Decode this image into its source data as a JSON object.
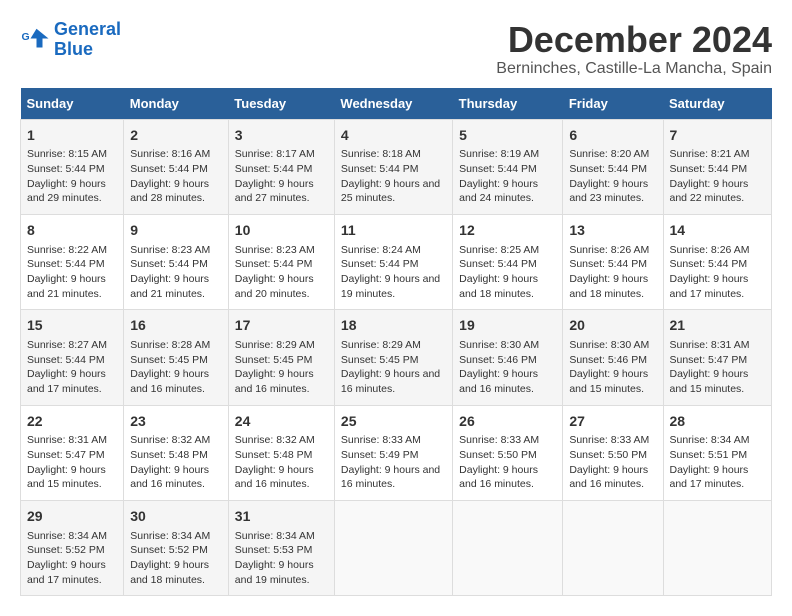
{
  "logo": {
    "line1": "General",
    "line2": "Blue"
  },
  "title": "December 2024",
  "subtitle": "Berninches, Castille-La Mancha, Spain",
  "headers": [
    "Sunday",
    "Monday",
    "Tuesday",
    "Wednesday",
    "Thursday",
    "Friday",
    "Saturday"
  ],
  "weeks": [
    [
      {
        "day": "1",
        "sunrise": "8:15 AM",
        "sunset": "5:44 PM",
        "daylight": "9 hours and 29 minutes."
      },
      {
        "day": "2",
        "sunrise": "8:16 AM",
        "sunset": "5:44 PM",
        "daylight": "9 hours and 28 minutes."
      },
      {
        "day": "3",
        "sunrise": "8:17 AM",
        "sunset": "5:44 PM",
        "daylight": "9 hours and 27 minutes."
      },
      {
        "day": "4",
        "sunrise": "8:18 AM",
        "sunset": "5:44 PM",
        "daylight": "9 hours and 25 minutes."
      },
      {
        "day": "5",
        "sunrise": "8:19 AM",
        "sunset": "5:44 PM",
        "daylight": "9 hours and 24 minutes."
      },
      {
        "day": "6",
        "sunrise": "8:20 AM",
        "sunset": "5:44 PM",
        "daylight": "9 hours and 23 minutes."
      },
      {
        "day": "7",
        "sunrise": "8:21 AM",
        "sunset": "5:44 PM",
        "daylight": "9 hours and 22 minutes."
      }
    ],
    [
      {
        "day": "8",
        "sunrise": "8:22 AM",
        "sunset": "5:44 PM",
        "daylight": "9 hours and 21 minutes."
      },
      {
        "day": "9",
        "sunrise": "8:23 AM",
        "sunset": "5:44 PM",
        "daylight": "9 hours and 21 minutes."
      },
      {
        "day": "10",
        "sunrise": "8:23 AM",
        "sunset": "5:44 PM",
        "daylight": "9 hours and 20 minutes."
      },
      {
        "day": "11",
        "sunrise": "8:24 AM",
        "sunset": "5:44 PM",
        "daylight": "9 hours and 19 minutes."
      },
      {
        "day": "12",
        "sunrise": "8:25 AM",
        "sunset": "5:44 PM",
        "daylight": "9 hours and 18 minutes."
      },
      {
        "day": "13",
        "sunrise": "8:26 AM",
        "sunset": "5:44 PM",
        "daylight": "9 hours and 18 minutes."
      },
      {
        "day": "14",
        "sunrise": "8:26 AM",
        "sunset": "5:44 PM",
        "daylight": "9 hours and 17 minutes."
      }
    ],
    [
      {
        "day": "15",
        "sunrise": "8:27 AM",
        "sunset": "5:44 PM",
        "daylight": "9 hours and 17 minutes."
      },
      {
        "day": "16",
        "sunrise": "8:28 AM",
        "sunset": "5:45 PM",
        "daylight": "9 hours and 16 minutes."
      },
      {
        "day": "17",
        "sunrise": "8:29 AM",
        "sunset": "5:45 PM",
        "daylight": "9 hours and 16 minutes."
      },
      {
        "day": "18",
        "sunrise": "8:29 AM",
        "sunset": "5:45 PM",
        "daylight": "9 hours and 16 minutes."
      },
      {
        "day": "19",
        "sunrise": "8:30 AM",
        "sunset": "5:46 PM",
        "daylight": "9 hours and 16 minutes."
      },
      {
        "day": "20",
        "sunrise": "8:30 AM",
        "sunset": "5:46 PM",
        "daylight": "9 hours and 15 minutes."
      },
      {
        "day": "21",
        "sunrise": "8:31 AM",
        "sunset": "5:47 PM",
        "daylight": "9 hours and 15 minutes."
      }
    ],
    [
      {
        "day": "22",
        "sunrise": "8:31 AM",
        "sunset": "5:47 PM",
        "daylight": "9 hours and 15 minutes."
      },
      {
        "day": "23",
        "sunrise": "8:32 AM",
        "sunset": "5:48 PM",
        "daylight": "9 hours and 16 minutes."
      },
      {
        "day": "24",
        "sunrise": "8:32 AM",
        "sunset": "5:48 PM",
        "daylight": "9 hours and 16 minutes."
      },
      {
        "day": "25",
        "sunrise": "8:33 AM",
        "sunset": "5:49 PM",
        "daylight": "9 hours and 16 minutes."
      },
      {
        "day": "26",
        "sunrise": "8:33 AM",
        "sunset": "5:50 PM",
        "daylight": "9 hours and 16 minutes."
      },
      {
        "day": "27",
        "sunrise": "8:33 AM",
        "sunset": "5:50 PM",
        "daylight": "9 hours and 16 minutes."
      },
      {
        "day": "28",
        "sunrise": "8:34 AM",
        "sunset": "5:51 PM",
        "daylight": "9 hours and 17 minutes."
      }
    ],
    [
      {
        "day": "29",
        "sunrise": "8:34 AM",
        "sunset": "5:52 PM",
        "daylight": "9 hours and 17 minutes."
      },
      {
        "day": "30",
        "sunrise": "8:34 AM",
        "sunset": "5:52 PM",
        "daylight": "9 hours and 18 minutes."
      },
      {
        "day": "31",
        "sunrise": "8:34 AM",
        "sunset": "5:53 PM",
        "daylight": "9 hours and 19 minutes."
      },
      null,
      null,
      null,
      null
    ]
  ]
}
